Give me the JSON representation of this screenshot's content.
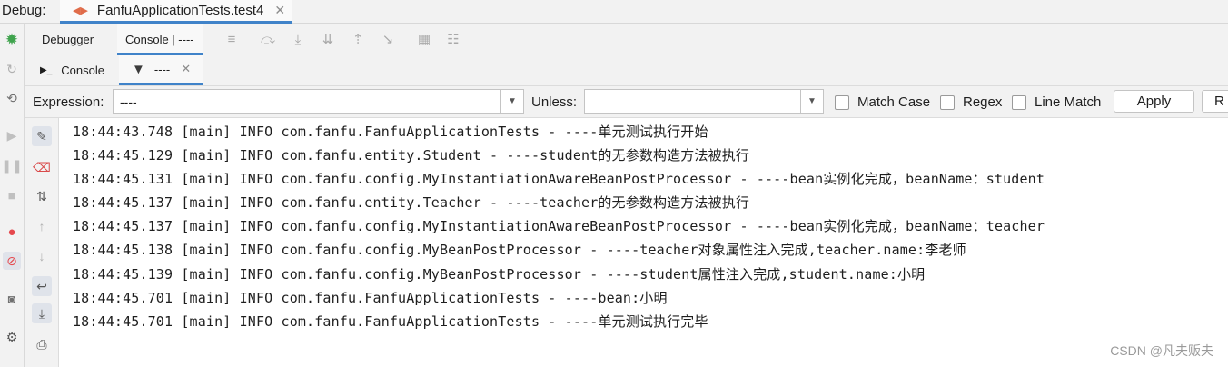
{
  "header": {
    "label": "Debug:",
    "run_tab": "FanfuApplicationTests.test4",
    "close_glyph": "✕"
  },
  "toolbar": {
    "tabs": [
      "Debugger",
      "Console | ----"
    ]
  },
  "subtabs": {
    "console": "Console",
    "filter": "----",
    "close_glyph": "✕"
  },
  "filter": {
    "expression_label": "Expression:",
    "expression_value": "----",
    "unless_label": "Unless:",
    "unless_value": "",
    "match_case": "Match Case",
    "regex": "Regex",
    "line_match": "Line Match",
    "apply": "Apply",
    "next_button": "R"
  },
  "console": {
    "lines": [
      "18:44:43.748 [main] INFO com.fanfu.FanfuApplicationTests - ----单元测试执行开始",
      "18:44:45.129 [main] INFO com.fanfu.entity.Student - ----student的无参数构造方法被执行",
      "18:44:45.131 [main] INFO com.fanfu.config.MyInstantiationAwareBeanPostProcessor - ----bean实例化完成，beanName：student",
      "18:44:45.137 [main] INFO com.fanfu.entity.Teacher - ----teacher的无参数构造方法被执行",
      "18:44:45.137 [main] INFO com.fanfu.config.MyInstantiationAwareBeanPostProcessor - ----bean实例化完成，beanName：teacher",
      "18:44:45.138 [main] INFO com.fanfu.config.MyBeanPostProcessor - ----teacher对象属性注入完成,teacher.name:李老师",
      "18:44:45.139 [main] INFO com.fanfu.config.MyBeanPostProcessor - ----student属性注入完成,student.name:小明",
      "18:44:45.701 [main] INFO com.fanfu.FanfuApplicationTests - ----bean:小明",
      "18:44:45.701 [main] INFO com.fanfu.FanfuApplicationTests - ----单元测试执行完毕"
    ]
  },
  "watermark": "CSDN @凡夫贩夫",
  "colors": {
    "accent": "#4083c9",
    "panel": "#f2f2f2",
    "debug_green": "#3fa34d",
    "record_red": "#e5484d"
  },
  "icons": {
    "left_bar": [
      "bug-icon",
      "resume-rerun-icon",
      "restart-icon",
      "resume-icon",
      "pause-icon",
      "stop-icon",
      "breakpoints-icon",
      "mute-breakpoints-icon",
      "camera-icon",
      "settings-icon"
    ],
    "toolbar": [
      "menu-icon",
      "show-execution-point-icon",
      "step-over-icon",
      "step-into-icon",
      "step-out-icon",
      "run-to-cursor-icon",
      "evaluate-icon",
      "trace-icon"
    ],
    "gutter": [
      "pin-icon",
      "clear-icon",
      "sort-icon",
      "up-arrow-icon",
      "down-arrow-icon",
      "soft-wrap-icon",
      "scroll-to-end-icon",
      "print-icon"
    ]
  }
}
